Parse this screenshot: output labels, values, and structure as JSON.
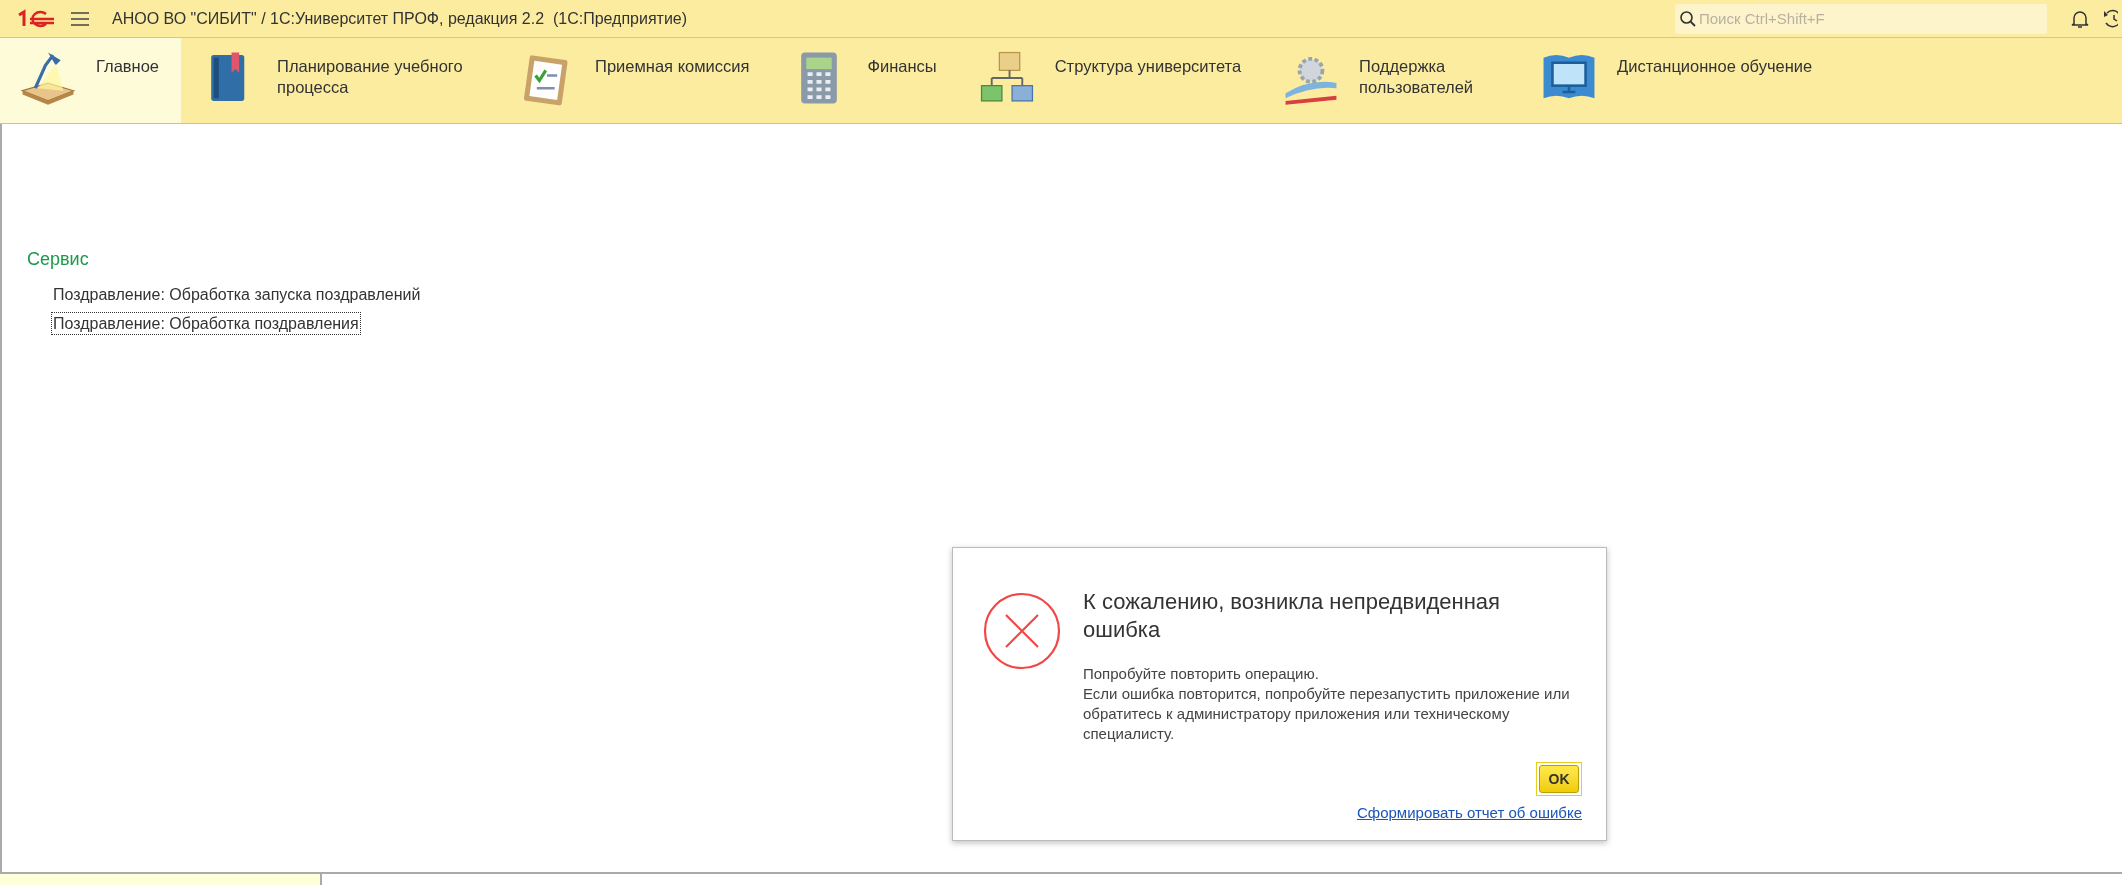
{
  "title_bar": {
    "title": "АНОО ВО \"СИБИТ\" / 1С:Университет ПРОФ, редакция 2.2  (1С:Предприятие)",
    "search": {
      "placeholder": "Поиск Ctrl+Shift+F"
    }
  },
  "sections": [
    {
      "label": "Главное",
      "kind": "lamp",
      "selected": true
    },
    {
      "label": "Планирование учебного процесса",
      "kind": "book",
      "selected": false
    },
    {
      "label": "Приемная комиссия",
      "kind": "clipboard",
      "selected": false
    },
    {
      "label": "Финансы",
      "kind": "calculator",
      "selected": false
    },
    {
      "label": "Структура университета",
      "kind": "structure",
      "selected": false
    },
    {
      "label": "Поддержка пользователей",
      "kind": "support",
      "selected": false
    },
    {
      "label": "Дистанционное обучение",
      "kind": "monitor",
      "selected": false
    }
  ],
  "content": {
    "group_title": "Сервис",
    "links": [
      {
        "label": "Поздравление: Обработка запуска поздравлений",
        "focused": false
      },
      {
        "label": "Поздравление: Обработка поздравления",
        "focused": true
      }
    ]
  },
  "dialog": {
    "title": "К сожалению, возникла непредвиденная ошибка",
    "message": [
      "Попробуйте повторить операцию.",
      "Если ошибка повторится, попробуйте перезапустить приложение или обратитесь к администратору приложения или техническому специалисту."
    ],
    "button": "OK",
    "report_link": "Сформировать отчет об ошибке"
  }
}
